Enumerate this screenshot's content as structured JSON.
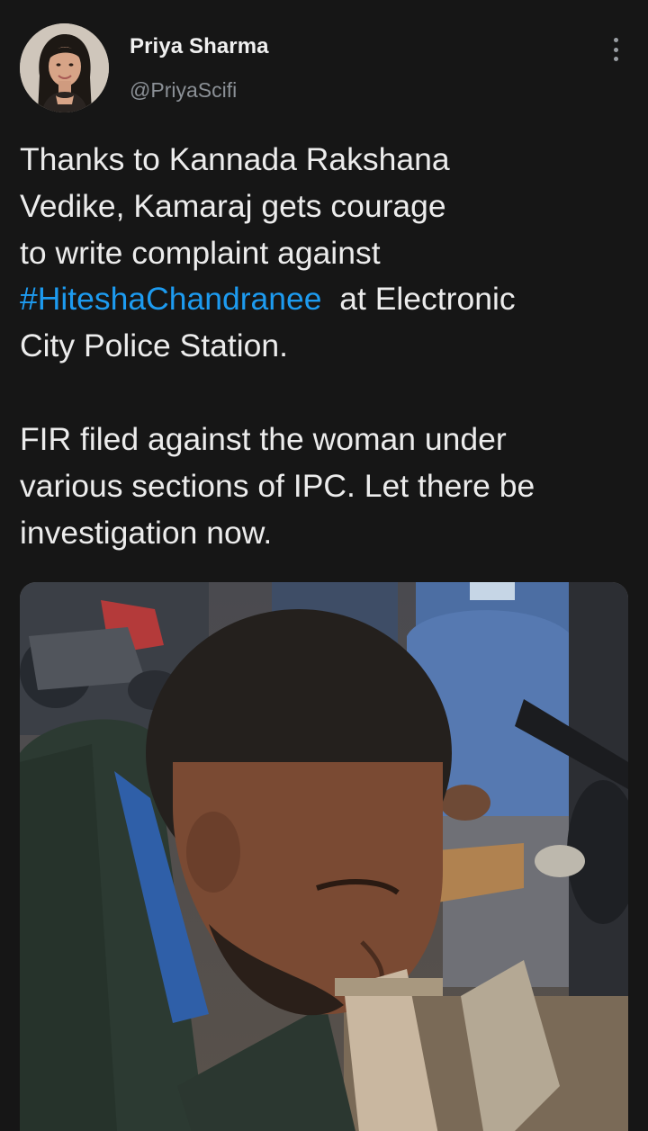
{
  "tweet": {
    "author": {
      "display_name": "Priya Sharma",
      "handle": "@PriyaScifi",
      "avatar": "profile-photo-woman"
    },
    "more_icon": "vertical-ellipsis-icon",
    "text": {
      "line1": "Thanks to Kannada Rakshana",
      "line2": "Vedike, Kamaraj gets courage",
      "line3": "to write complaint against",
      "hashtag": "#HiteshaChandranee",
      "line4_rest": "at Electronic",
      "line5": "City Police Station.",
      "line6": "FIR filed against the woman under",
      "line7": "various sections of IPC. Let there be",
      "line8": "investigation now."
    },
    "media": {
      "description": "photo-man-writing-near-motorcycles"
    },
    "colors": {
      "background": "#161616",
      "hashtag": "#1d9bf0",
      "handle": "#8b9096"
    }
  }
}
